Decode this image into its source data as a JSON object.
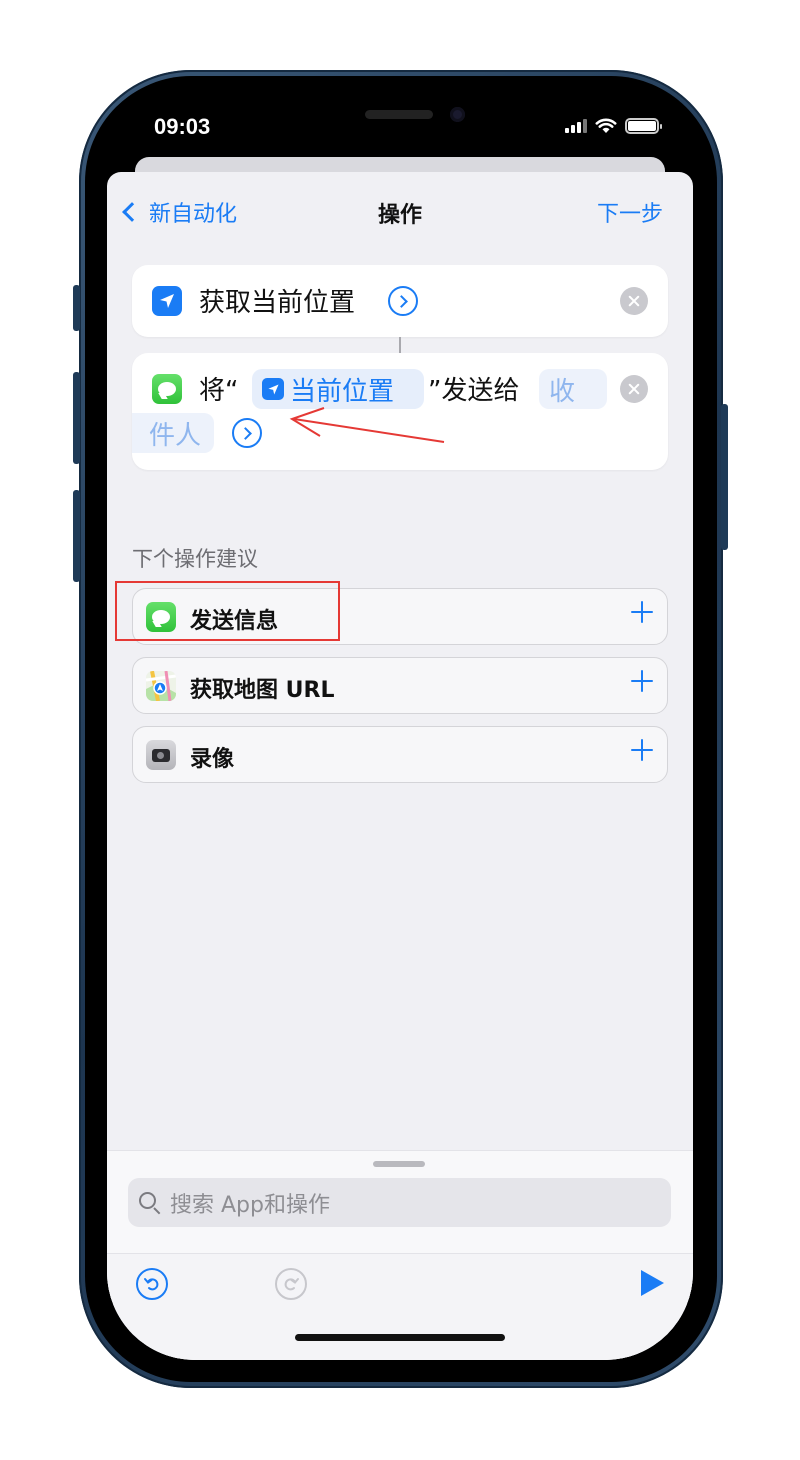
{
  "status_bar": {
    "time": "09:03"
  },
  "nav": {
    "back_label": "新自动化",
    "title": "操作",
    "next_label": "下一步"
  },
  "actions": [
    {
      "title": "获取当前位置",
      "icon": "location-arrow-icon"
    },
    {
      "prefix": "将“",
      "variable_token": "当前位置",
      "middle": "”发送给",
      "recipient_line1": "收",
      "recipient_line2": "件人",
      "icon": "messages-icon"
    }
  ],
  "suggestions": {
    "label": "下个操作建议",
    "items": [
      {
        "label": "发送信息",
        "icon": "messages-icon"
      },
      {
        "label": "获取地图 URL",
        "icon": "maps-icon"
      },
      {
        "label": "录像",
        "icon": "camera-icon"
      }
    ]
  },
  "search": {
    "placeholder": "搜索 App和操作"
  },
  "annotations": {
    "arrow_color": "#e53935",
    "highlight_color": "#e53935"
  },
  "colors": {
    "accent": "#1a7cf5",
    "messages_green": "#34c759",
    "phone_frame": "#1d3550"
  }
}
